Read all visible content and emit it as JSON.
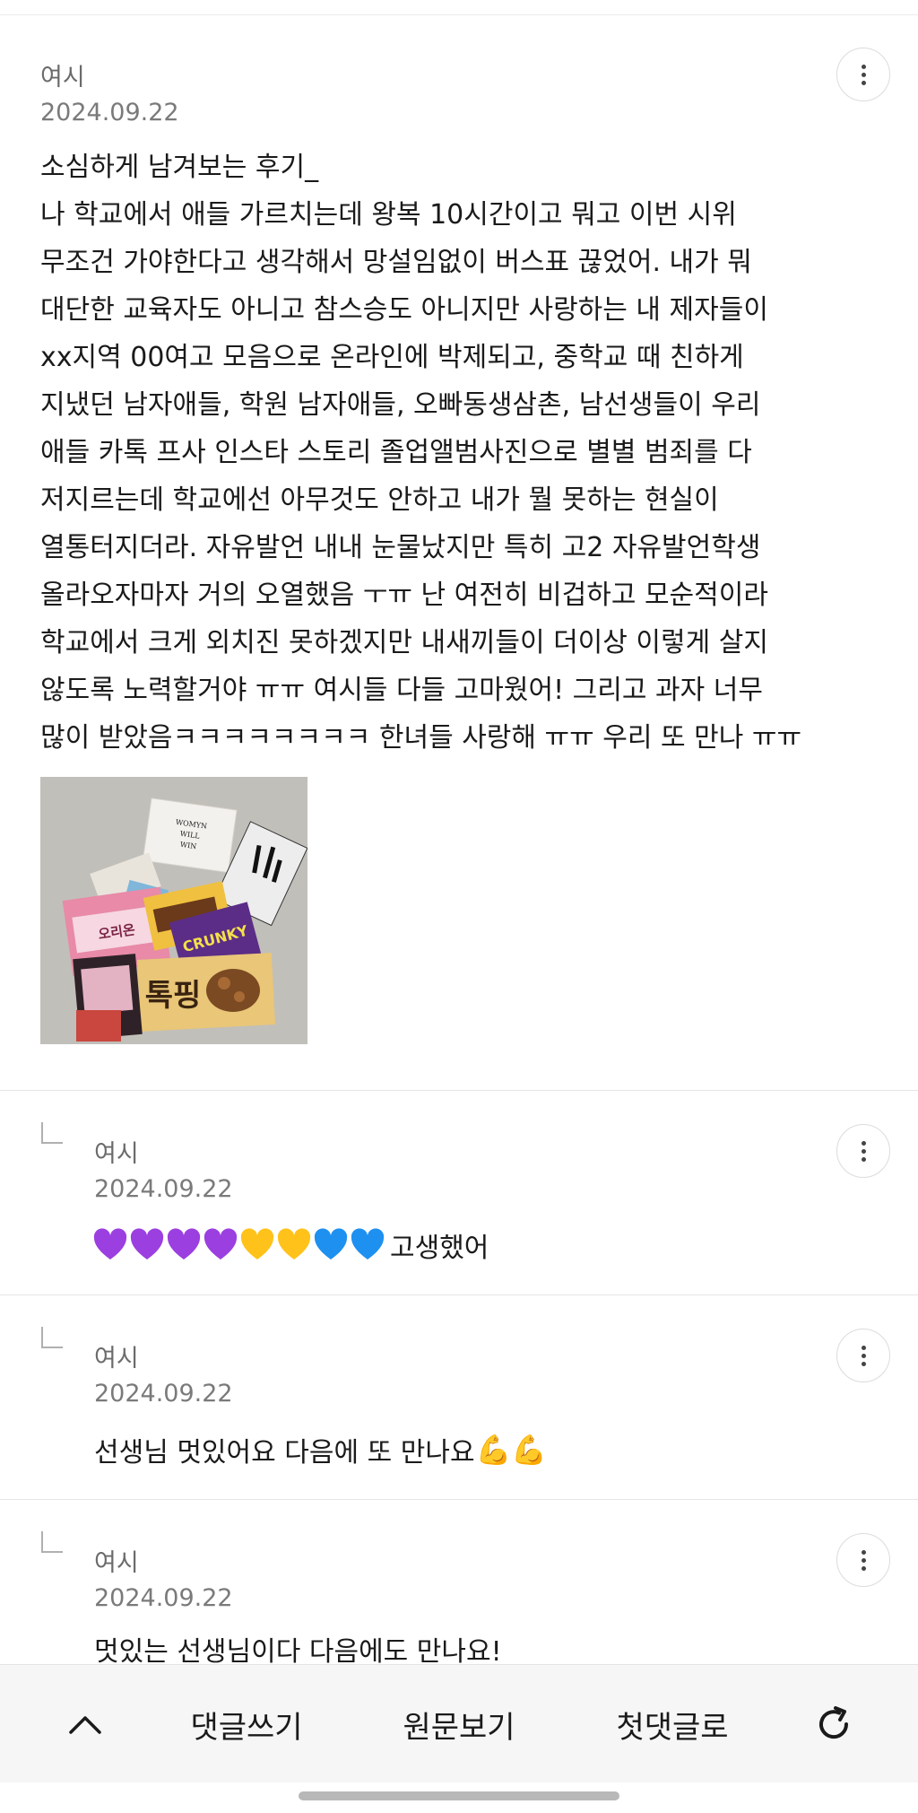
{
  "post": {
    "author": "여시",
    "date": "2024.09.22",
    "lines": [
      "소심하게 남겨보는 후기_",
      "나 학교에서 애들 가르치는데 왕복 10시간이고 뭐고 이번 시위",
      "무조건 가야한다고 생각해서 망설임없이 버스표 끊었어. 내가 뭐",
      "대단한 교육자도 아니고 참스승도 아니지만 사랑하는 내 제자들이",
      "xx지역 00여고 모음으로 온라인에 박제되고, 중학교 때 친하게",
      "지냈던 남자애들, 학원 남자애들, 오빠동생삼촌, 남선생들이 우리",
      "애들 카톡 프사 인스타 스토리 졸업앨범사진으로 별별 범죄를 다",
      "저지르는데 학교에선 아무것도 안하고 내가 뭘 못하는 현실이",
      "열통터지더라. 자유발언 내내 눈물났지만 특히 고2 자유발언학생",
      "올라오자마자 거의 오열했음 ㅜㅠ 난 여전히 비겁하고 모순적이라",
      "학교에서 크게 외치진 못하겠지만 내새끼들이 더이상 이렇게 살지",
      "않도록 노력할거야 ㅠㅠ 여시들 다들 고마웠어! 그리고 과자 너무",
      "많이 받았음ㅋㅋㅋㅋㅋㅋㅋㅋ 한녀들 사랑해 ㅠㅠ 우리 또 만나 ㅠㅠ"
    ],
    "photo_label": "WOMYN WILL WIN"
  },
  "replies": [
    {
      "author": "여시",
      "date": "2024.09.22",
      "emojis": [
        "purple-heart",
        "purple-heart",
        "purple-heart",
        "purple-heart",
        "yellow-heart",
        "yellow-heart",
        "blue-heart",
        "blue-heart"
      ],
      "text": "고생했어"
    },
    {
      "author": "여시",
      "date": "2024.09.22",
      "text": "선생님 멋있어요 다음에 또 만나요",
      "emoji": "💪💪"
    },
    {
      "author": "여시",
      "date": "2024.09.22",
      "text": "멋있는 선생님이다 다음에도 만나요!"
    }
  ],
  "colors": {
    "purple": "#9b3fe0",
    "yellow": "#ffc21a",
    "blue": "#1e90f0"
  },
  "bottom_bar": {
    "up_icon": "chevron-up-icon",
    "write_comment": "댓글쓰기",
    "view_original": "원문보기",
    "first_comment": "첫댓글로",
    "refresh_icon": "refresh-icon"
  }
}
